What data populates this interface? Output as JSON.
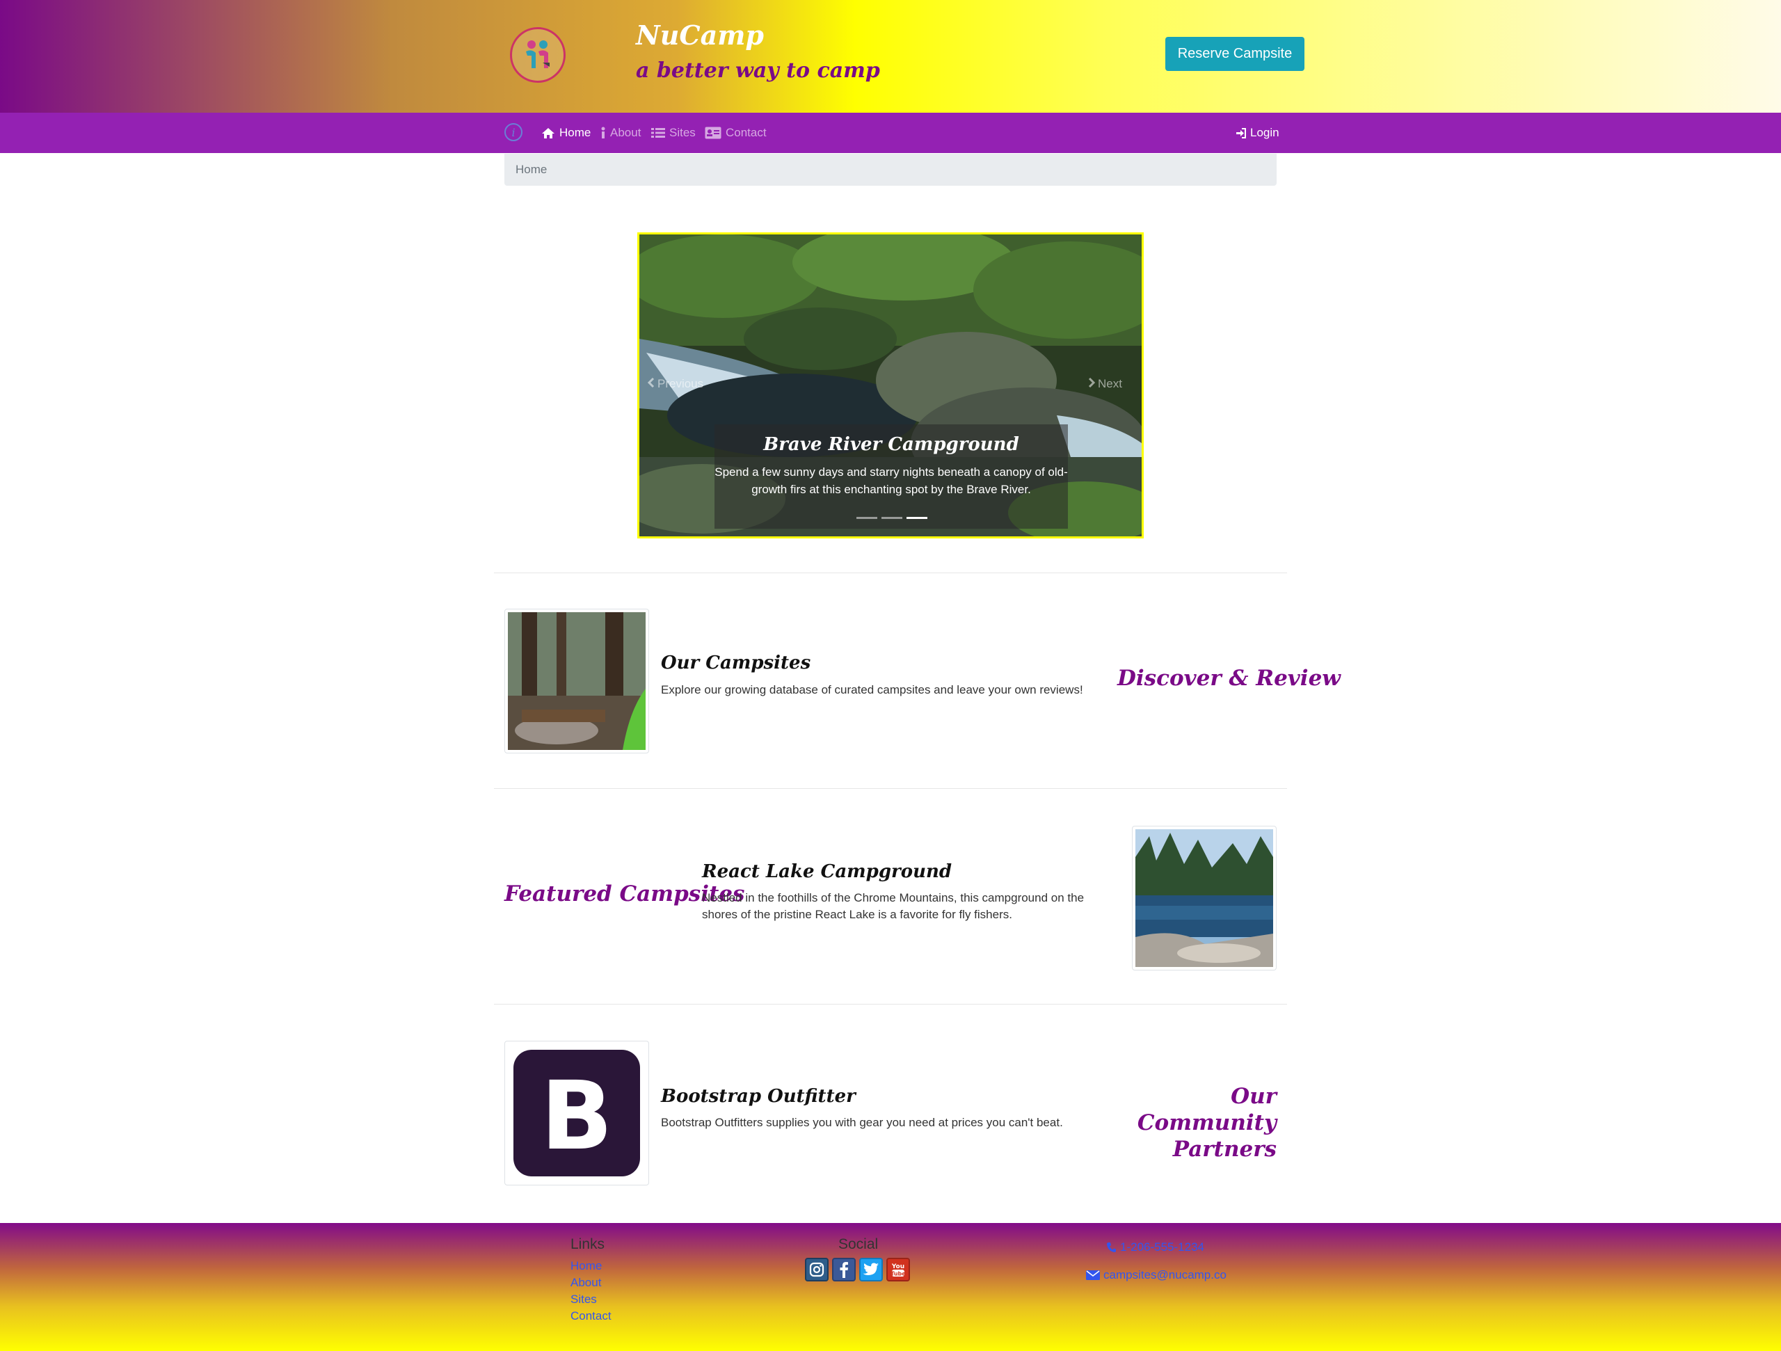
{
  "header": {
    "brand": "NuCamp",
    "tagline": "a better way to camp",
    "logo_icon": "nucamp-logo-icon",
    "reserve_label": "Reserve Campsite"
  },
  "nav": {
    "items": [
      {
        "label": "Home",
        "icon": "home-icon",
        "active": true
      },
      {
        "label": "About",
        "icon": "info-icon",
        "active": false
      },
      {
        "label": "Sites",
        "icon": "list-icon",
        "active": false
      },
      {
        "label": "Contact",
        "icon": "address-card-icon",
        "active": false
      }
    ],
    "login_label": "Login"
  },
  "breadcrumb": {
    "current": "Home"
  },
  "carousel": {
    "prev_label": "Previous",
    "next_label": "Next",
    "caption_title": "Brave River Campground",
    "caption_text": "Spend a few sunny days and starry nights beneath a canopy of old-growth firs at this enchanting spot by the Brave River.",
    "slides": 3,
    "active_slide": 3
  },
  "sections": {
    "campsites": {
      "title": "Our Campsites",
      "text": "Explore our growing database of curated campsites and leave your own reviews!",
      "heading": "Discover & Review"
    },
    "featured": {
      "heading": "Featured Campsites",
      "title": "React Lake Campground",
      "text": "Nestled in the foothills of the Chrome Mountains, this campground on the shores of the pristine React Lake is a favorite for fly fishers."
    },
    "partners": {
      "title": "Bootstrap Outfitter",
      "text": "Bootstrap Outfitters supplies you with gear you need at prices you can't beat.",
      "heading": "Our Community Partners",
      "logo_letter": "B"
    }
  },
  "footer": {
    "links_heading": "Links",
    "links": [
      "Home",
      "About",
      "Sites",
      "Contact"
    ],
    "social_heading": "Social",
    "social_icons": [
      "instagram-icon",
      "facebook-icon",
      "twitter-icon",
      "youtube-icon"
    ],
    "phone": "1-206-555-1234",
    "email": "campsites@nucamp.co"
  },
  "colors": {
    "accent": "#7a0a87",
    "navbar": "#9421b3",
    "button": "#17a2b8",
    "link": "#3355ee"
  }
}
